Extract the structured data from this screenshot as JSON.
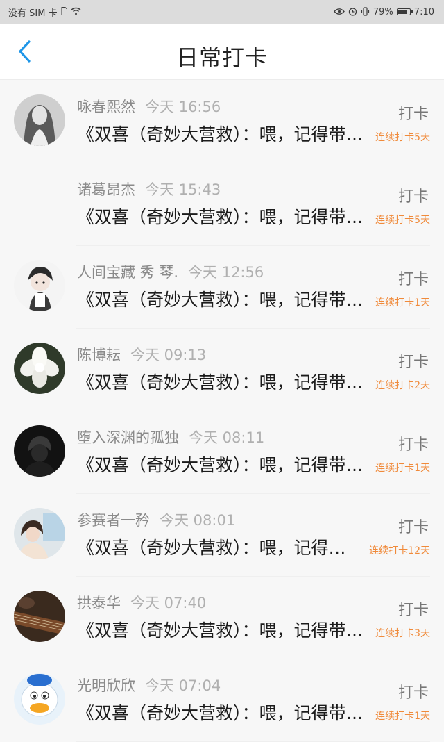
{
  "status_bar": {
    "carrier": "没有 SIM 卡",
    "battery": "79%",
    "battery_level": 0.79,
    "time": "7:10",
    "icons": [
      "sim-card-icon",
      "wifi-icon",
      "eye-icon",
      "alarm-icon",
      "vibrate-icon",
      "battery-icon"
    ]
  },
  "header": {
    "title": "日常打卡",
    "back_icon": "chevron-left-icon",
    "accent_color": "#1e96e8"
  },
  "colors": {
    "streak": "#f08a3a"
  },
  "entries": [
    {
      "name": "咏春熙然",
      "time": "今天 16:56",
      "message": "《双喜（奇妙大营救）：喂，记得带上你的……",
      "action": "打卡",
      "streak": "连续打卡5天",
      "avatar": "portrait-photo"
    },
    {
      "name": "诸葛昂杰",
      "time": "今天 15:43",
      "message": "《双喜（奇妙大营救）：喂，记得带上你的……",
      "action": "打卡",
      "streak": "连续打卡5天",
      "avatar": "blank"
    },
    {
      "name": "人间宝藏 秀 琴.",
      "time": "今天 12:56",
      "message": "《双喜（奇妙大营救）：喂，记得带上你的……",
      "action": "打卡",
      "streak": "连续打卡1天",
      "avatar": "anime-character"
    },
    {
      "name": "陈博耘",
      "time": "今天 09:13",
      "message": "《双喜（奇妙大营救）：喂，记得带上你的……",
      "action": "打卡",
      "streak": "连续打卡2天",
      "avatar": "white-flower"
    },
    {
      "name": "堕入深渊的孤独",
      "time": "今天 08:11",
      "message": "《双喜（奇妙大营救）：喂，记得带上你的……",
      "action": "打卡",
      "streak": "连续打卡1天",
      "avatar": "dark-figure"
    },
    {
      "name": "参赛者一矜",
      "time": "今天 08:01",
      "message": "《双喜（奇妙大营救）：喂，记得带上你的……",
      "action": "打卡",
      "streak": "连续打卡12天",
      "avatar": "girl-photo"
    },
    {
      "name": "拱泰华",
      "time": "今天 07:40",
      "message": "《双喜（奇妙大营救）：喂，记得带上你的……",
      "action": "打卡",
      "streak": "连续打卡3天",
      "avatar": "guzheng-instrument"
    },
    {
      "name": "光明欣欣",
      "time": "今天 07:04",
      "message": "《双喜（奇妙大营救）：喂，记得带上你的……",
      "action": "打卡",
      "streak": "连续打卡1天",
      "avatar": "cartoon-duck"
    }
  ]
}
